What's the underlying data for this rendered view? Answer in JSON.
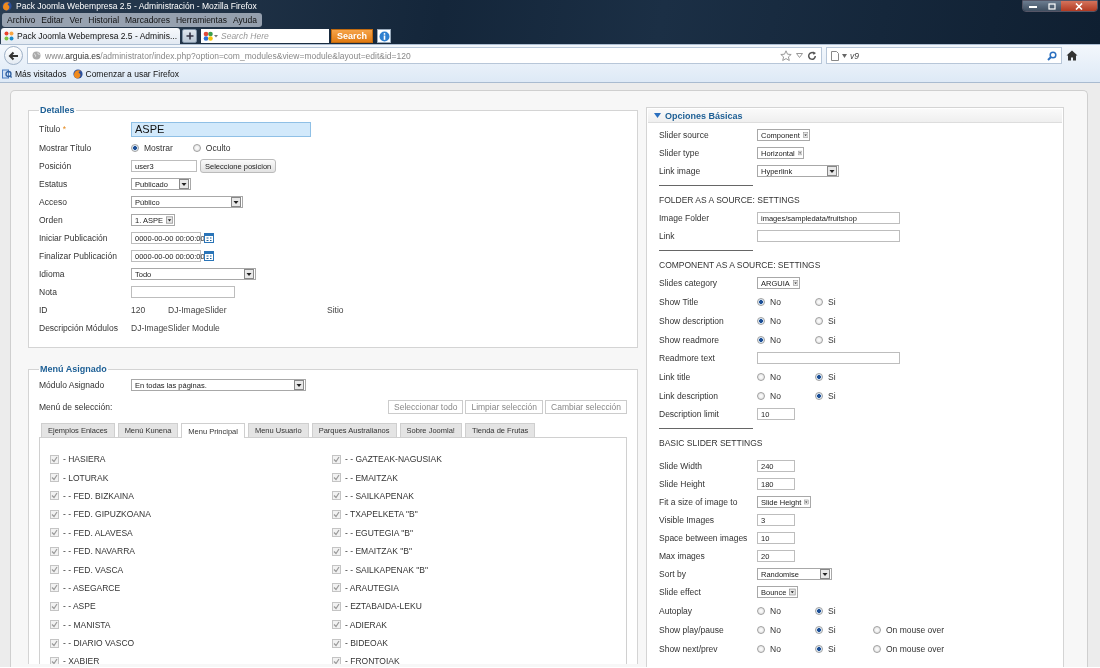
{
  "browser": {
    "title": "Pack Joomla Webempresa 2.5 - Administración - Mozilla Firefox",
    "menu": [
      "Archivo",
      "Editar",
      "Ver",
      "Historial",
      "Marcadores",
      "Herramientas",
      "Ayuda"
    ],
    "tabs": [
      {
        "label": "Pack Joomla Webempresa 2.5 - Adminis...",
        "selected": true
      }
    ],
    "search": {
      "placeholder": "Search Here",
      "button": "Search"
    },
    "url": "www.**arguia.es**/administrator/index.php?option=com_modules&view=module&layout=edit&id=120",
    "search_field": {
      "value": "v9"
    },
    "bookmarks": [
      "Más visitados",
      "Comenzar a usar Firefox"
    ]
  },
  "details": {
    "legend": "Detalles",
    "fields": [
      {
        "kind": "text",
        "label": "Título",
        "required_mark": "*",
        "focused": true,
        "value": "ASPE"
      },
      {
        "kind": "radio",
        "label": "Mostrar Título",
        "options": [
          {
            "label": "Mostrar",
            "selected": true
          },
          {
            "label": "Oculto",
            "selected": false
          }
        ]
      },
      {
        "kind": "text_button",
        "label": "Posición",
        "value": "user3",
        "button": "Seleccione posicion"
      },
      {
        "kind": "select",
        "label": "Estatus",
        "value": "Publicado"
      },
      {
        "kind": "select",
        "label": "Acceso",
        "value": "Público"
      },
      {
        "kind": "select",
        "label": "Orden",
        "value": "1. ASPE"
      },
      {
        "kind": "date",
        "label": "Iniciar Publicación",
        "value": "0000-00-00 00:00:00"
      },
      {
        "kind": "date",
        "label": "Finalizar Publicación",
        "value": "0000-00-00 00:00:00"
      },
      {
        "kind": "select",
        "label": "Idioma",
        "value": "Todo"
      },
      {
        "kind": "text",
        "label": "Nota",
        "focused": false
      },
      {
        "kind": "static",
        "label": "ID",
        "values": [
          "120",
          "DJ-ImageSlider",
          "Sitio"
        ]
      },
      {
        "kind": "static",
        "label": "Descripción Módulos",
        "values": [
          "DJ-ImageSlider Module"
        ]
      }
    ]
  },
  "menu": {
    "legend": "Menú Asignado",
    "module_label": "Módulo Asignado",
    "module_value": "En todas las páginas.",
    "selection_label": "Menú de selección:",
    "buttons": [
      "Seleccionar todo",
      "Limpiar selección",
      "Cambiar selección"
    ],
    "tabs": [
      {
        "label": "Ejemplos Enlaces",
        "selected": false
      },
      {
        "label": "Menú Kunena",
        "selected": false
      },
      {
        "label": "Menu Principal",
        "selected": true
      },
      {
        "label": "Menu Usuario",
        "selected": false
      },
      {
        "label": "Parques Australianos",
        "selected": false
      },
      {
        "label": "Sobre Joomla!",
        "selected": false
      },
      {
        "label": "Tienda de Frutas",
        "selected": false
      }
    ],
    "columns": [
      {
        "items": [
          {
            "label": "- HASIERA",
            "checked": true
          },
          {
            "label": "- LOTURAK",
            "checked": true
          },
          {
            "label": "- - FED. BIZKAINA",
            "checked": true
          },
          {
            "label": "- - FED. GIPUZKOANA",
            "checked": true
          },
          {
            "label": "- - FED. ALAVESA",
            "checked": true
          },
          {
            "label": "- - FED. NAVARRA",
            "checked": true
          },
          {
            "label": "- - FED. VASCA",
            "checked": true
          },
          {
            "label": "- - ASEGARCE",
            "checked": true
          },
          {
            "label": "- - ASPE",
            "checked": true
          },
          {
            "label": "- - MANISTA",
            "checked": true
          },
          {
            "label": "- - DIARIO VASCO",
            "checked": true
          },
          {
            "label": "- XABIER",
            "checked": true
          }
        ]
      },
      {
        "items": [
          {
            "label": "- - GAZTEAK-NAGUSIAK",
            "checked": true
          },
          {
            "label": "- - EMAITZAK",
            "checked": true
          },
          {
            "label": "- - SAILKAPENAK",
            "checked": true
          },
          {
            "label": "- TXAPELKETA \"B\"",
            "checked": true
          },
          {
            "label": "- - EGUTEGIA \"B\"",
            "checked": true
          },
          {
            "label": "- - EMAITZAK \"B\"",
            "checked": true
          },
          {
            "label": "- - SAILKAPENAK \"B\"",
            "checked": true
          },
          {
            "label": "- ARAUTEGIA",
            "checked": true
          },
          {
            "label": "- EZTABAIDA-LEKU",
            "checked": true
          },
          {
            "label": "- ADIERAK",
            "checked": true
          },
          {
            "label": "- BIDEOAK",
            "checked": true
          },
          {
            "label": "- FRONTOIAK",
            "checked": true
          }
        ]
      }
    ]
  },
  "options": {
    "title": "Opciones Básicas",
    "expanded": true,
    "rows": [
      {
        "kind": "select",
        "label": "Slider source",
        "value": "Component"
      },
      {
        "kind": "select",
        "label": "Slider type",
        "value": "Horizontal"
      },
      {
        "kind": "select",
        "label": "Link image",
        "value": "Hyperlink"
      },
      {
        "kind": "rule"
      },
      {
        "kind": "heading",
        "label": "FOLDER AS A SOURCE: SETTINGS"
      },
      {
        "kind": "text",
        "label": "Image Folder",
        "value": "images/sampledata/fruitshop"
      },
      {
        "kind": "text",
        "label": "Link"
      },
      {
        "kind": "rule"
      },
      {
        "kind": "heading",
        "label": "COMPONENT AS A SOURCE: SETTINGS"
      },
      {
        "kind": "select",
        "label": "Slides category",
        "value": "ARGUIA"
      },
      {
        "kind": "radio",
        "label": "Show Title",
        "options": [
          {
            "label": "No",
            "selected": true
          },
          {
            "label": "Si",
            "selected": false
          }
        ]
      },
      {
        "kind": "radio",
        "label": "Show description",
        "options": [
          {
            "label": "No",
            "selected": true
          },
          {
            "label": "Si",
            "selected": false
          }
        ]
      },
      {
        "kind": "radio",
        "label": "Show readmore",
        "options": [
          {
            "label": "No",
            "selected": true
          },
          {
            "label": "Si",
            "selected": false
          }
        ]
      },
      {
        "kind": "text",
        "label": "Readmore text"
      },
      {
        "kind": "radio",
        "label": "Link title",
        "options": [
          {
            "label": "No",
            "selected": false
          },
          {
            "label": "Si",
            "selected": true
          }
        ]
      },
      {
        "kind": "radio",
        "label": "Link description",
        "options": [
          {
            "label": "No",
            "selected": false
          },
          {
            "label": "Si",
            "selected": true
          }
        ]
      },
      {
        "kind": "text",
        "label": "Description limit",
        "value": "10"
      },
      {
        "kind": "rule"
      },
      {
        "kind": "heading",
        "label": "BASIC SLIDER SETTINGS"
      },
      {
        "kind": "text",
        "label": "Slide Width",
        "value": "240"
      },
      {
        "kind": "text",
        "label": "Slide Height",
        "value": "180"
      },
      {
        "kind": "select",
        "label": "Fit a size of image to",
        "value": "Slide Height"
      },
      {
        "kind": "text",
        "label": "Visible Images",
        "value": "3"
      },
      {
        "kind": "text",
        "label": "Space between images",
        "value": "10"
      },
      {
        "kind": "text",
        "label": "Max images",
        "value": "20"
      },
      {
        "kind": "select",
        "label": "Sort by",
        "value": "Randomise"
      },
      {
        "kind": "select",
        "label": "Slide effect",
        "value": "Bounce"
      },
      {
        "kind": "radio",
        "label": "Autoplay",
        "options": [
          {
            "label": "No",
            "selected": false
          },
          {
            "label": "Si",
            "selected": true
          }
        ]
      },
      {
        "kind": "radio",
        "label": "Show play/pause",
        "options": [
          {
            "label": "No",
            "selected": false
          },
          {
            "label": "Si",
            "selected": true
          },
          {
            "label": "On mouse over",
            "selected": false
          }
        ]
      },
      {
        "kind": "radio",
        "label": "Show next/prev",
        "options": [
          {
            "label": "No",
            "selected": false
          },
          {
            "label": "Si",
            "selected": true
          },
          {
            "label": "On mouse over",
            "selected": false
          }
        ]
      }
    ]
  }
}
